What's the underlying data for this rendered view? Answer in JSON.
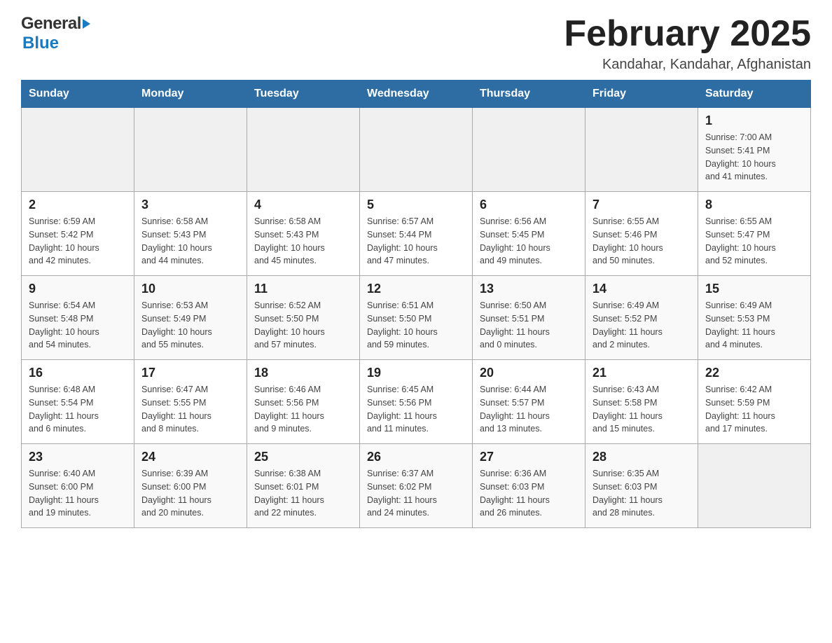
{
  "header": {
    "logo_general": "General",
    "logo_blue": "Blue",
    "title": "February 2025",
    "location": "Kandahar, Kandahar, Afghanistan"
  },
  "weekdays": [
    "Sunday",
    "Monday",
    "Tuesday",
    "Wednesday",
    "Thursday",
    "Friday",
    "Saturday"
  ],
  "weeks": [
    [
      {
        "day": "",
        "info": ""
      },
      {
        "day": "",
        "info": ""
      },
      {
        "day": "",
        "info": ""
      },
      {
        "day": "",
        "info": ""
      },
      {
        "day": "",
        "info": ""
      },
      {
        "day": "",
        "info": ""
      },
      {
        "day": "1",
        "info": "Sunrise: 7:00 AM\nSunset: 5:41 PM\nDaylight: 10 hours\nand 41 minutes."
      }
    ],
    [
      {
        "day": "2",
        "info": "Sunrise: 6:59 AM\nSunset: 5:42 PM\nDaylight: 10 hours\nand 42 minutes."
      },
      {
        "day": "3",
        "info": "Sunrise: 6:58 AM\nSunset: 5:43 PM\nDaylight: 10 hours\nand 44 minutes."
      },
      {
        "day": "4",
        "info": "Sunrise: 6:58 AM\nSunset: 5:43 PM\nDaylight: 10 hours\nand 45 minutes."
      },
      {
        "day": "5",
        "info": "Sunrise: 6:57 AM\nSunset: 5:44 PM\nDaylight: 10 hours\nand 47 minutes."
      },
      {
        "day": "6",
        "info": "Sunrise: 6:56 AM\nSunset: 5:45 PM\nDaylight: 10 hours\nand 49 minutes."
      },
      {
        "day": "7",
        "info": "Sunrise: 6:55 AM\nSunset: 5:46 PM\nDaylight: 10 hours\nand 50 minutes."
      },
      {
        "day": "8",
        "info": "Sunrise: 6:55 AM\nSunset: 5:47 PM\nDaylight: 10 hours\nand 52 minutes."
      }
    ],
    [
      {
        "day": "9",
        "info": "Sunrise: 6:54 AM\nSunset: 5:48 PM\nDaylight: 10 hours\nand 54 minutes."
      },
      {
        "day": "10",
        "info": "Sunrise: 6:53 AM\nSunset: 5:49 PM\nDaylight: 10 hours\nand 55 minutes."
      },
      {
        "day": "11",
        "info": "Sunrise: 6:52 AM\nSunset: 5:50 PM\nDaylight: 10 hours\nand 57 minutes."
      },
      {
        "day": "12",
        "info": "Sunrise: 6:51 AM\nSunset: 5:50 PM\nDaylight: 10 hours\nand 59 minutes."
      },
      {
        "day": "13",
        "info": "Sunrise: 6:50 AM\nSunset: 5:51 PM\nDaylight: 11 hours\nand 0 minutes."
      },
      {
        "day": "14",
        "info": "Sunrise: 6:49 AM\nSunset: 5:52 PM\nDaylight: 11 hours\nand 2 minutes."
      },
      {
        "day": "15",
        "info": "Sunrise: 6:49 AM\nSunset: 5:53 PM\nDaylight: 11 hours\nand 4 minutes."
      }
    ],
    [
      {
        "day": "16",
        "info": "Sunrise: 6:48 AM\nSunset: 5:54 PM\nDaylight: 11 hours\nand 6 minutes."
      },
      {
        "day": "17",
        "info": "Sunrise: 6:47 AM\nSunset: 5:55 PM\nDaylight: 11 hours\nand 8 minutes."
      },
      {
        "day": "18",
        "info": "Sunrise: 6:46 AM\nSunset: 5:56 PM\nDaylight: 11 hours\nand 9 minutes."
      },
      {
        "day": "19",
        "info": "Sunrise: 6:45 AM\nSunset: 5:56 PM\nDaylight: 11 hours\nand 11 minutes."
      },
      {
        "day": "20",
        "info": "Sunrise: 6:44 AM\nSunset: 5:57 PM\nDaylight: 11 hours\nand 13 minutes."
      },
      {
        "day": "21",
        "info": "Sunrise: 6:43 AM\nSunset: 5:58 PM\nDaylight: 11 hours\nand 15 minutes."
      },
      {
        "day": "22",
        "info": "Sunrise: 6:42 AM\nSunset: 5:59 PM\nDaylight: 11 hours\nand 17 minutes."
      }
    ],
    [
      {
        "day": "23",
        "info": "Sunrise: 6:40 AM\nSunset: 6:00 PM\nDaylight: 11 hours\nand 19 minutes."
      },
      {
        "day": "24",
        "info": "Sunrise: 6:39 AM\nSunset: 6:00 PM\nDaylight: 11 hours\nand 20 minutes."
      },
      {
        "day": "25",
        "info": "Sunrise: 6:38 AM\nSunset: 6:01 PM\nDaylight: 11 hours\nand 22 minutes."
      },
      {
        "day": "26",
        "info": "Sunrise: 6:37 AM\nSunset: 6:02 PM\nDaylight: 11 hours\nand 24 minutes."
      },
      {
        "day": "27",
        "info": "Sunrise: 6:36 AM\nSunset: 6:03 PM\nDaylight: 11 hours\nand 26 minutes."
      },
      {
        "day": "28",
        "info": "Sunrise: 6:35 AM\nSunset: 6:03 PM\nDaylight: 11 hours\nand 28 minutes."
      },
      {
        "day": "",
        "info": ""
      }
    ]
  ]
}
